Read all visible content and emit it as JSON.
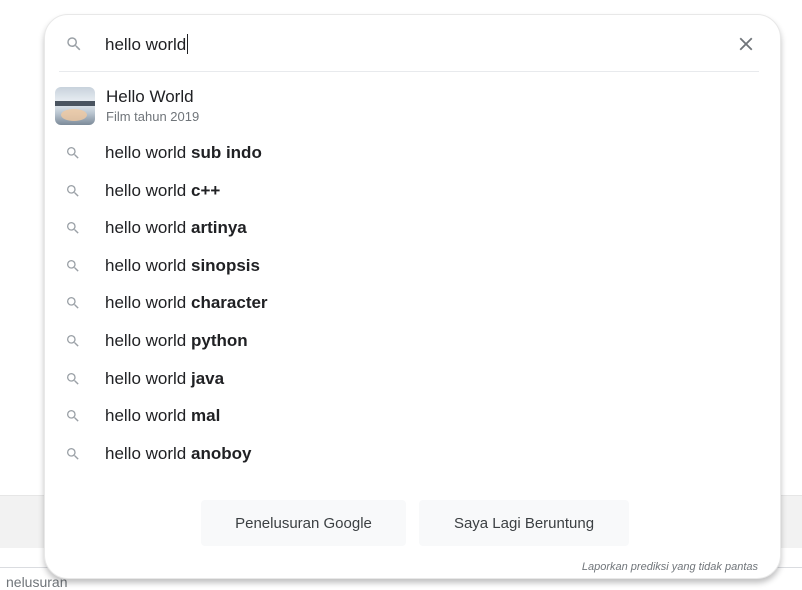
{
  "search": {
    "query": "hello world",
    "clear_icon": "close-icon",
    "search_icon": "search-icon"
  },
  "entity": {
    "title": "Hello World",
    "subtitle": "Film tahun 2019",
    "thumbnail": "movie-poster-thumbnail"
  },
  "suggestions": [
    {
      "prefix": "hello world ",
      "bold": "sub indo"
    },
    {
      "prefix": "hello world ",
      "bold": "c++"
    },
    {
      "prefix": "hello world ",
      "bold": "artinya"
    },
    {
      "prefix": "hello world ",
      "bold": "sinopsis"
    },
    {
      "prefix": "hello world ",
      "bold": "character"
    },
    {
      "prefix": "hello world ",
      "bold": "python"
    },
    {
      "prefix": "hello world ",
      "bold": "java"
    },
    {
      "prefix": "hello world ",
      "bold": "mal"
    },
    {
      "prefix": "hello world ",
      "bold": "anoboy"
    }
  ],
  "buttons": {
    "search_label": "Penelusuran Google",
    "lucky_label": "Saya Lagi Beruntung"
  },
  "report_link": "Laporkan prediksi yang tidak pantas",
  "background": {
    "partial_text": "nelusuran"
  },
  "colors": {
    "text": "#202124",
    "secondary_text": "#70757a",
    "icon": "#9aa0a6",
    "button_bg": "#f8f9fa"
  }
}
